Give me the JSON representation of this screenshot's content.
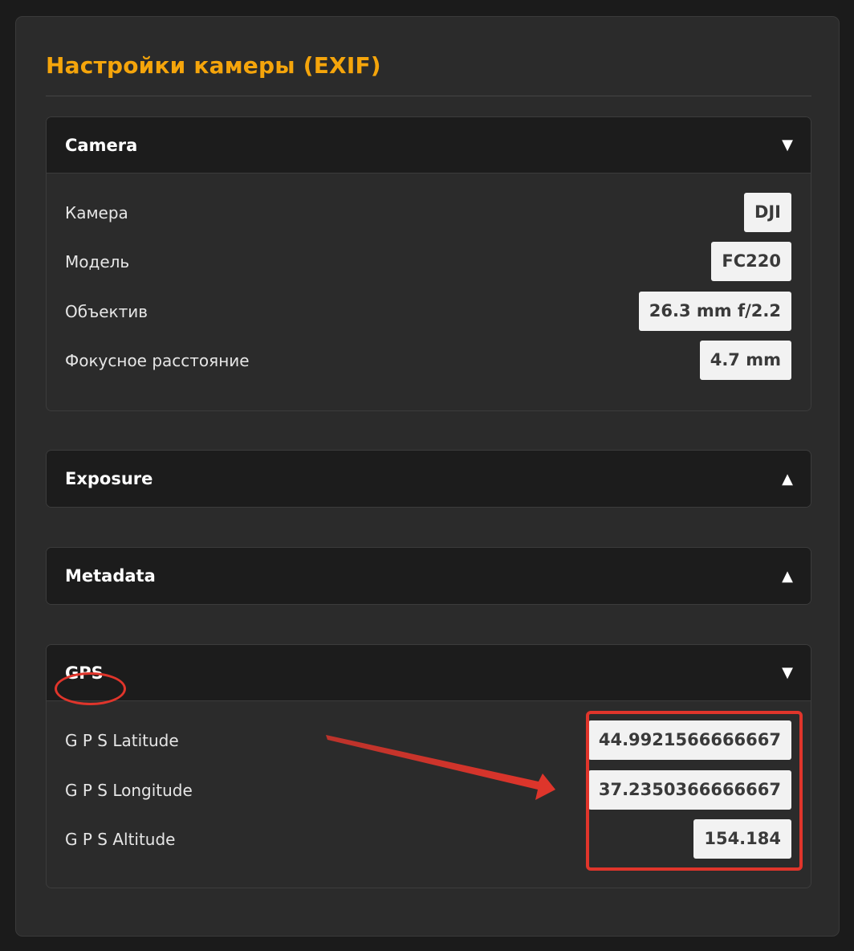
{
  "title": "Настройки камеры (EXIF)",
  "sections": {
    "camera": {
      "title": "Camera",
      "arrow": "▼",
      "rows": [
        {
          "label": "Камера",
          "value": "DJI"
        },
        {
          "label": "Модель",
          "value": "FC220"
        },
        {
          "label": "Объектив",
          "value": "26.3 mm f/2.2"
        },
        {
          "label": "Фокусное расстояние",
          "value": "4.7 mm"
        }
      ]
    },
    "exposure": {
      "title": "Exposure",
      "arrow": "▲"
    },
    "metadata": {
      "title": "Metadata",
      "arrow": "▲"
    },
    "gps": {
      "title": "GPS",
      "arrow": "▼",
      "rows": [
        {
          "label": "G P S Latitude",
          "value": "44.9921566666667"
        },
        {
          "label": "G P S Longitude",
          "value": "37.2350366666667"
        },
        {
          "label": "G P S Altitude",
          "value": "154.184"
        }
      ]
    }
  },
  "colors": {
    "accent": "#f5a50b",
    "annotation": "#e0352b",
    "panel": "#2b2b2b",
    "header": "#1c1c1c"
  },
  "icons": {
    "collapse": "chevron-down-icon",
    "expand": "chevron-up-icon"
  }
}
